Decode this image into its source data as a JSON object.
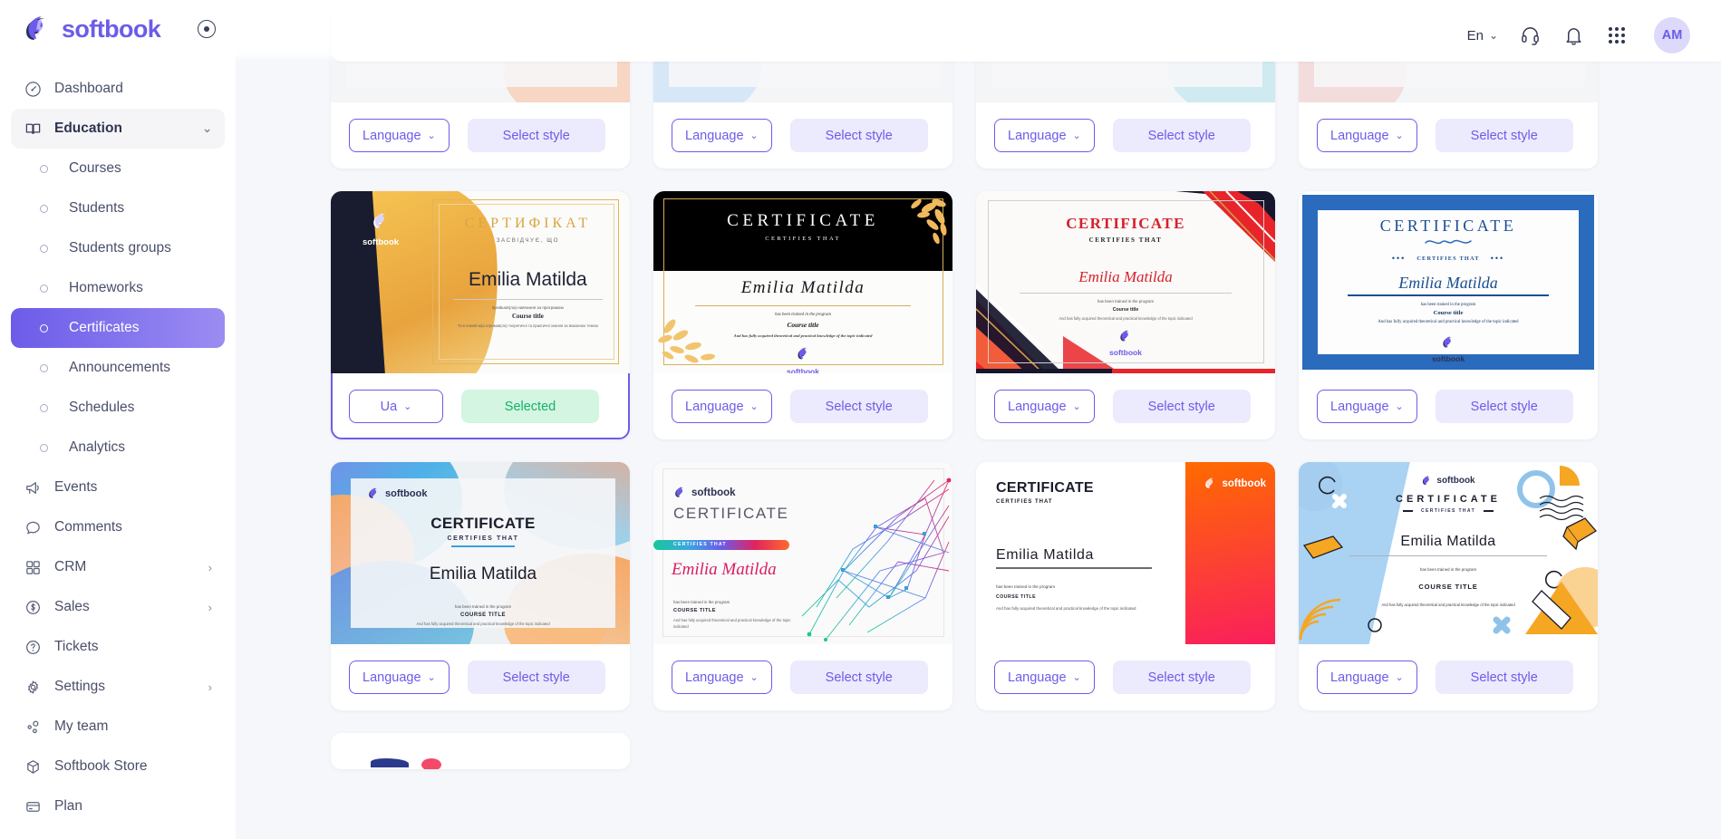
{
  "brand": {
    "name": "softbook",
    "collapse_icon": "circle-dot-icon"
  },
  "sidebar": {
    "items": [
      {
        "label": "Dashboard",
        "icon": "gauge-icon",
        "type": "item",
        "state": "default"
      },
      {
        "label": "Education",
        "icon": "book-open-icon",
        "type": "group",
        "state": "expanded",
        "chevron": "⌄"
      },
      {
        "label": "Courses",
        "icon": "radio-dot-icon",
        "type": "sub",
        "state": "default"
      },
      {
        "label": "Students",
        "icon": "radio-dot-icon",
        "type": "sub",
        "state": "default"
      },
      {
        "label": "Students groups",
        "icon": "radio-dot-icon",
        "type": "sub",
        "state": "default"
      },
      {
        "label": "Homeworks",
        "icon": "radio-dot-icon",
        "type": "sub",
        "state": "default"
      },
      {
        "label": "Certificates",
        "icon": "radio-dot-icon",
        "type": "sub",
        "state": "active"
      },
      {
        "label": "Announcements",
        "icon": "radio-dot-icon",
        "type": "sub",
        "state": "default"
      },
      {
        "label": "Schedules",
        "icon": "radio-dot-icon",
        "type": "sub",
        "state": "default"
      },
      {
        "label": "Analytics",
        "icon": "radio-dot-icon",
        "type": "sub",
        "state": "default"
      },
      {
        "label": "Events",
        "icon": "megaphone-icon",
        "type": "item",
        "state": "default"
      },
      {
        "label": "Comments",
        "icon": "chat-bubble-icon",
        "type": "item",
        "state": "default"
      },
      {
        "label": "CRM",
        "icon": "grid-squares-icon",
        "type": "item",
        "state": "default",
        "chevron": "›"
      },
      {
        "label": "Sales",
        "icon": "dollar-circle-icon",
        "type": "item",
        "state": "default",
        "chevron": "›"
      },
      {
        "label": "Tickets",
        "icon": "question-circle-icon",
        "type": "item",
        "state": "default"
      },
      {
        "label": "Settings",
        "icon": "gear-icon",
        "type": "item",
        "state": "default",
        "chevron": "›"
      },
      {
        "label": "My team",
        "icon": "people-nodes-icon",
        "type": "item",
        "state": "default"
      },
      {
        "label": "Softbook Store",
        "icon": "box-icon",
        "type": "item",
        "state": "default"
      },
      {
        "label": "Plan",
        "icon": "card-icon",
        "type": "item",
        "state": "default"
      }
    ]
  },
  "topbar": {
    "language": "En",
    "language_chevron": "⌄",
    "icons": [
      "headset-icon",
      "bell-icon",
      "apps-grid-icon"
    ],
    "avatar_initials": "AM"
  },
  "colors": {
    "accent": "#6c5ce9",
    "accent_soft": "#eceafd",
    "selected_bg": "#d3f5e1",
    "selected_text": "#17b06b",
    "page_bg": "#f6f7fb",
    "sidebar_bg": "#ffffff"
  },
  "labels": {
    "language": "Language",
    "language_ua": "Ua",
    "select_style": "Select style",
    "selected": "Selected",
    "chevron_down": "⌄"
  },
  "certificate_text": {
    "title_en": "CERTIFICATE",
    "subtitle_en": "CERTIFIES THAT",
    "name": "Emilia Matilda",
    "trained_line": "has been trained in the program",
    "course_title": "Course title",
    "course_title_caps": "COURSE TITLE",
    "acquired_line": "And has fully acquired theoretical and practical knowledge of the topic indicated",
    "title_ua": "СЕРТИФІКАТ",
    "subtitle_ua": "ЗАСВІДЧУЄ, ЩО",
    "trained_line_ua": "пройшов(ла) навчання за програмою",
    "acquired_line_ua": "Та в повній мірі отримав(ла) теоретичні та практичні знання за вказаною темою",
    "brand": "softbook"
  },
  "cards": [
    {
      "id": "r1c1",
      "style": "hidden-top",
      "language_label": "Language",
      "action_label": "Select style",
      "selected": false
    },
    {
      "id": "r1c2",
      "style": "hidden-top",
      "language_label": "Language",
      "action_label": "Select style",
      "selected": false
    },
    {
      "id": "r1c3",
      "style": "hidden-top",
      "language_label": "Language",
      "action_label": "Select style",
      "selected": false
    },
    {
      "id": "r1c4",
      "style": "hidden-top",
      "language_label": "Language",
      "action_label": "Select style",
      "selected": false
    },
    {
      "id": "r2c1",
      "style": "gold-ukrainian",
      "language_label": "Ua",
      "action_label": "Selected",
      "selected": true
    },
    {
      "id": "r2c2",
      "style": "black-gold-leaves",
      "language_label": "Language",
      "action_label": "Select style",
      "selected": false
    },
    {
      "id": "r2c3",
      "style": "red-diagonal",
      "language_label": "Language",
      "action_label": "Select style",
      "selected": false
    },
    {
      "id": "r2c4",
      "style": "blue-ornate-border",
      "language_label": "Language",
      "action_label": "Select style",
      "selected": false
    },
    {
      "id": "r3c1",
      "style": "pastel-blobs",
      "language_label": "Language",
      "action_label": "Select style",
      "selected": false
    },
    {
      "id": "r3c2",
      "style": "network-gradient",
      "language_label": "Language",
      "action_label": "Select style",
      "selected": false
    },
    {
      "id": "r3c3",
      "style": "orange-panel",
      "language_label": "Language",
      "action_label": "Select style",
      "selected": false
    },
    {
      "id": "r3c4",
      "style": "memphis-pastel",
      "language_label": "Language",
      "action_label": "Select style",
      "selected": false
    }
  ]
}
